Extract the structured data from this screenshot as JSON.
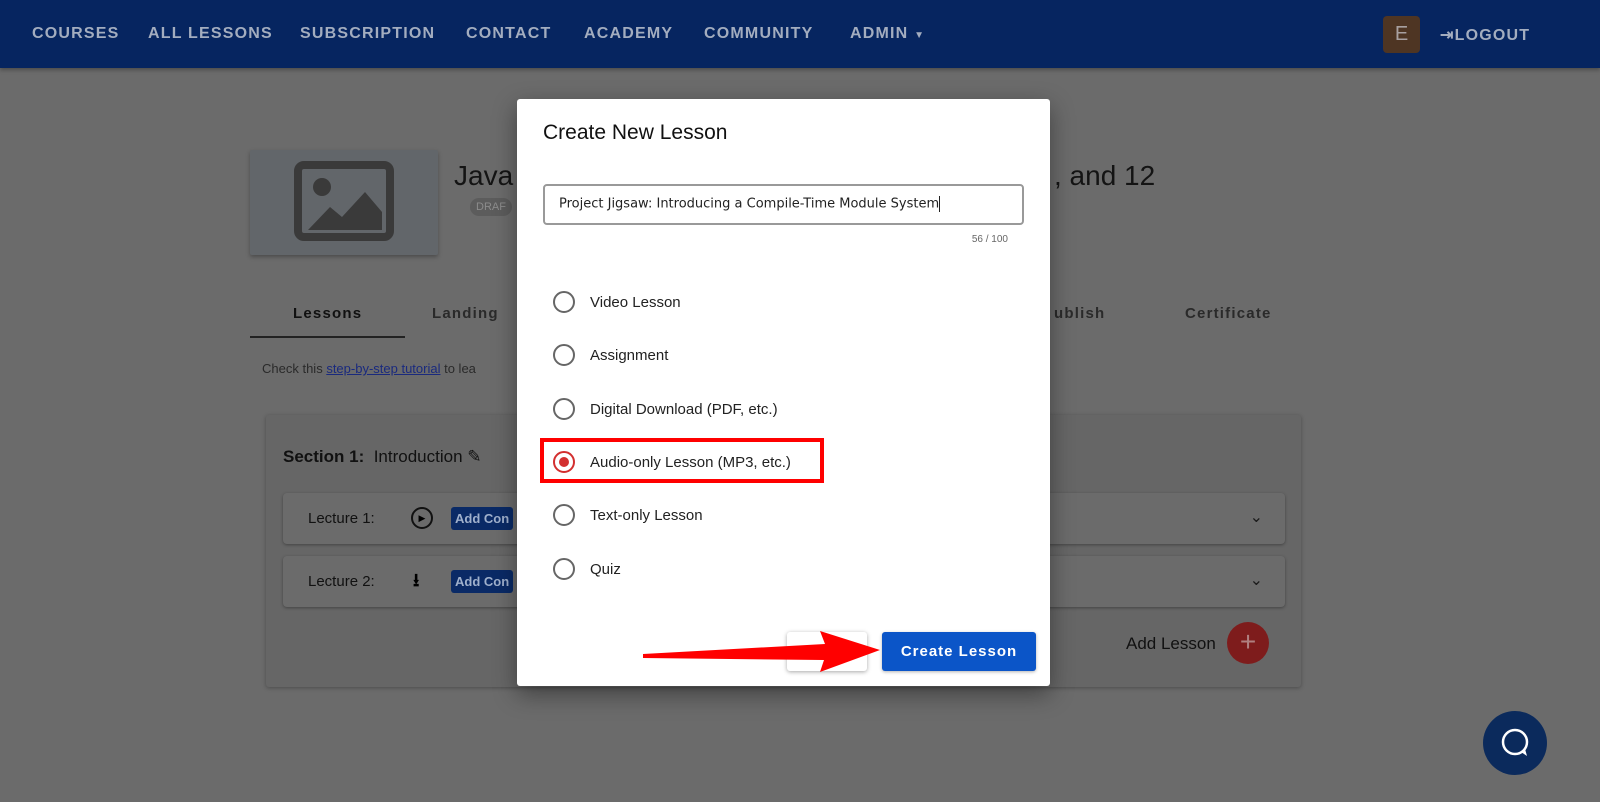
{
  "nav": {
    "items": [
      "COURSES",
      "ALL LESSONS",
      "SUBSCRIPTION",
      "CONTACT",
      "ACADEMY",
      "COMMUNITY",
      "ADMIN"
    ],
    "avatar_letter": "E",
    "logout": "LOGOUT"
  },
  "course": {
    "title_left": "Java",
    "title_right": ", and 12",
    "badge": "DRAF"
  },
  "tabs": [
    "Lessons",
    "Landing",
    "ublish",
    "Certificate"
  ],
  "hint": {
    "prefix": "Check this ",
    "link": "step-by-step tutorial",
    "suffix": " to lea"
  },
  "section": {
    "label": "Section 1:",
    "name": "Introduction",
    "lectures": [
      {
        "label": "Lecture 1:",
        "icon": "play-circle",
        "button": "Add Con"
      },
      {
        "label": "Lecture 2:",
        "icon": "download",
        "button": "Add Con"
      }
    ],
    "add_lesson": "Add Lesson"
  },
  "modal": {
    "title": "Create New Lesson",
    "input_value": "Project Jigsaw: Introducing a Compile-Time Module System",
    "counter": "56 / 100",
    "options": [
      {
        "label": "Video Lesson",
        "selected": false
      },
      {
        "label": "Assignment",
        "selected": false
      },
      {
        "label": "Digital Download (PDF, etc.)",
        "selected": false
      },
      {
        "label": "Audio-only Lesson (MP3, etc.)",
        "selected": true
      },
      {
        "label": "Text-only Lesson",
        "selected": false
      },
      {
        "label": "Quiz",
        "selected": false
      }
    ],
    "create_label": "Create Lesson"
  },
  "colors": {
    "nav": "#0f4fc0",
    "primary": "#0b55c8",
    "selected_radio": "#d32f2f",
    "highlight": "#ff0000"
  }
}
